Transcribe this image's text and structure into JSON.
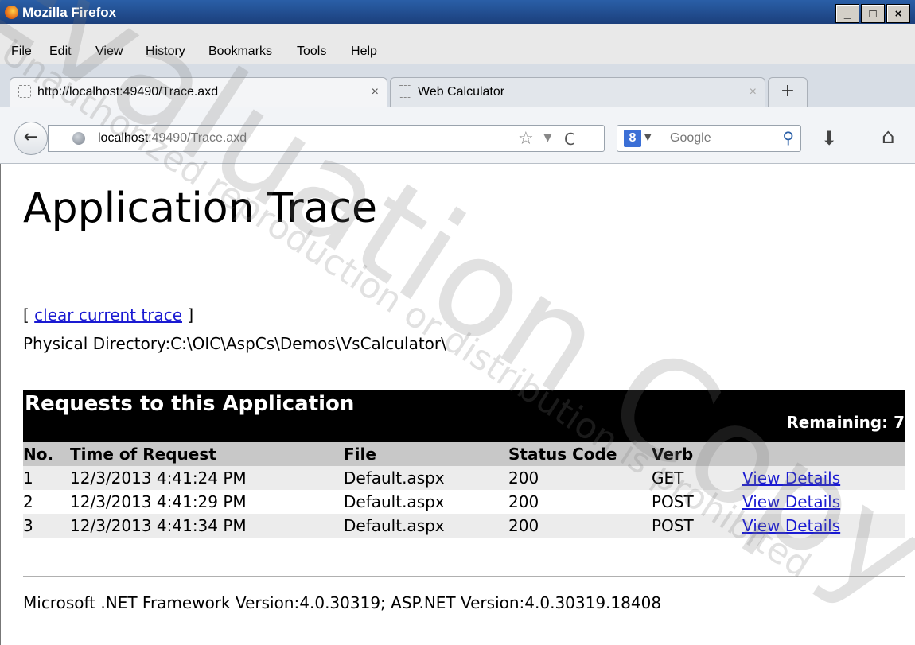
{
  "window": {
    "title": "Mozilla Firefox",
    "controls": [
      "_",
      "□",
      "×"
    ]
  },
  "menu": [
    "File",
    "Edit",
    "View",
    "History",
    "Bookmarks",
    "Tools",
    "Help"
  ],
  "tabs": [
    {
      "label": "http://localhost:49490/Trace.axd",
      "close": "×"
    },
    {
      "label": "Web Calculator",
      "close": "×"
    }
  ],
  "newtab_label": "+",
  "nav": {
    "back": "←",
    "url_host": "localhost",
    "url_rest": ":49490/Trace.axd",
    "reload": "C",
    "search_engine_badge": "8",
    "search_placeholder": "Google"
  },
  "page": {
    "heading": "Application Trace",
    "open_bracket": "[",
    "clear_link": "clear current trace",
    "close_bracket": "]",
    "physical_directory": "Physical Directory:C:\\OIC\\AspCs\\Demos\\VsCalculator\\",
    "requests_title": "Requests to this Application",
    "remaining": "Remaining: 7",
    "columns": [
      "No.",
      "Time of Request",
      "File",
      "Status Code",
      "Verb"
    ],
    "rows": [
      {
        "no": "1",
        "time": "12/3/2013 4:41:24 PM",
        "file": "Default.aspx",
        "status": "200",
        "verb": "GET",
        "link": "View Details"
      },
      {
        "no": "2",
        "time": "12/3/2013 4:41:29 PM",
        "file": "Default.aspx",
        "status": "200",
        "verb": "POST",
        "link": "View Details"
      },
      {
        "no": "3",
        "time": "12/3/2013 4:41:34 PM",
        "file": "Default.aspx",
        "status": "200",
        "verb": "POST",
        "link": "View Details"
      }
    ],
    "footer": "Microsoft .NET Framework Version:4.0.30319; ASP.NET Version:4.0.30319.18408"
  },
  "watermark": {
    "big": "Evaluation Copy",
    "small": "Unauthorized reproduction or distribution is prohibited"
  },
  "colors": {
    "link": "#1a1ad2",
    "titlebar": "#1b3f7c",
    "header_bg": "#000000"
  }
}
